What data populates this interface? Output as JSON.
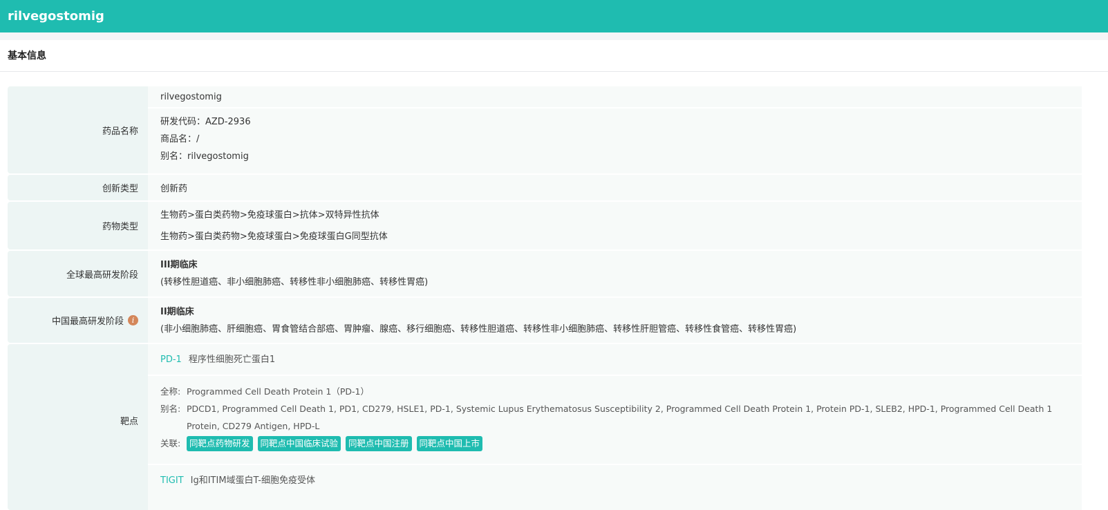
{
  "header": {
    "title": "rilvegostomig"
  },
  "section": {
    "title": "基本信息"
  },
  "rows": {
    "name": {
      "label": "药品名称",
      "main": "rilvegostomig",
      "code": "研发代码：AZD-2936",
      "trade": "商品名：/",
      "alias": "别名：rilvegostomig"
    },
    "innovation": {
      "label": "创新类型",
      "value": "创新药"
    },
    "drug_type": {
      "label": "药物类型",
      "values": [
        "生物药>蛋白类药物>免疫球蛋白>抗体>双特异性抗体",
        "生物药>蛋白类药物>免疫球蛋白>免疫球蛋白G同型抗体"
      ]
    },
    "global": {
      "label": "全球最高研发阶段",
      "stage": "III期临床",
      "indications": "(转移性胆道癌、非小细胞肺癌、转移性非小细胞肺癌、转移性胃癌)"
    },
    "china": {
      "label": "中国最高研发阶段",
      "info_icon": "i",
      "stage": "II期临床",
      "indications": "(非小细胞肺癌、肝细胞癌、胃食管结合部癌、胃肿瘤、腺癌、移行细胞癌、转移性胆道癌、转移性非小细胞肺癌、转移性肝胆管癌、转移性食管癌、转移性胃癌)"
    },
    "targets": {
      "label": "靶点",
      "items": [
        {
          "code": "PD-1",
          "name": "程序性细胞死亡蛋白1",
          "fullname_label": "全称:",
          "fullname": "Programmed Cell Death Protein 1（PD-1）",
          "alias_label": "别名:",
          "alias": "PDCD1, Programmed Cell Death 1, PD1, CD279, HSLE1, PD-1, Systemic Lupus Erythematosus Susceptibility 2, Programmed Cell Death Protein 1, Protein PD-1, SLEB2, HPD-1, Programmed Cell Death 1 Protein, CD279 Antigen, HPD-L",
          "related_label": "关联:",
          "related": [
            "同靶点药物研发",
            "同靶点中国临床试验",
            "同靶点中国注册",
            "同靶点中国上市"
          ]
        },
        {
          "code": "TIGIT",
          "name": "Ig和ITIM域蛋白T-细胞免疫受体"
        }
      ]
    }
  }
}
